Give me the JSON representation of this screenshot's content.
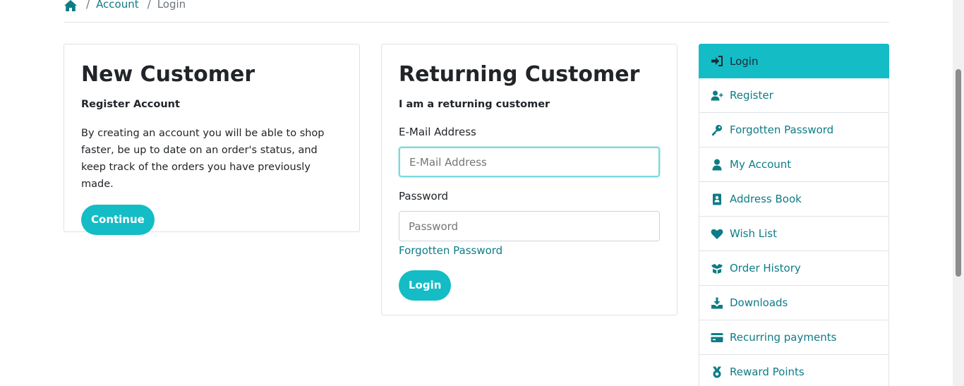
{
  "breadcrumb": {
    "home_icon": "home-icon",
    "sep": "/",
    "account": "Account",
    "current": "Login"
  },
  "new_customer": {
    "title": "New Customer",
    "subtitle": "Register Account",
    "body": "By creating an account you will be able to shop faster, be up to date on an order's status, and keep track of the orders you have previously made.",
    "button": "Continue"
  },
  "returning_customer": {
    "title": "Returning Customer",
    "subtitle": "I am a returning customer",
    "email_label": "E-Mail Address",
    "email_placeholder": "E-Mail Address",
    "email_value": "",
    "password_label": "Password",
    "password_placeholder": "Password",
    "password_value": "",
    "forgot_link": "Forgotten Password",
    "button": "Login"
  },
  "side_menu": {
    "items": [
      {
        "label": "Login",
        "icon": "sign-in-icon",
        "active": true
      },
      {
        "label": "Register",
        "icon": "user-plus-icon"
      },
      {
        "label": "Forgotten Password",
        "icon": "key-icon"
      },
      {
        "label": "My Account",
        "icon": "user-icon"
      },
      {
        "label": "Address Book",
        "icon": "address-book-icon"
      },
      {
        "label": "Wish List",
        "icon": "heart-icon"
      },
      {
        "label": "Order History",
        "icon": "box-open-icon"
      },
      {
        "label": "Downloads",
        "icon": "download-icon"
      },
      {
        "label": "Recurring payments",
        "icon": "credit-card-icon"
      },
      {
        "label": "Reward Points",
        "icon": "medal-icon"
      }
    ]
  },
  "colors": {
    "accent": "#14bcc6",
    "link": "#0e7c86",
    "border": "#dee2e6"
  }
}
